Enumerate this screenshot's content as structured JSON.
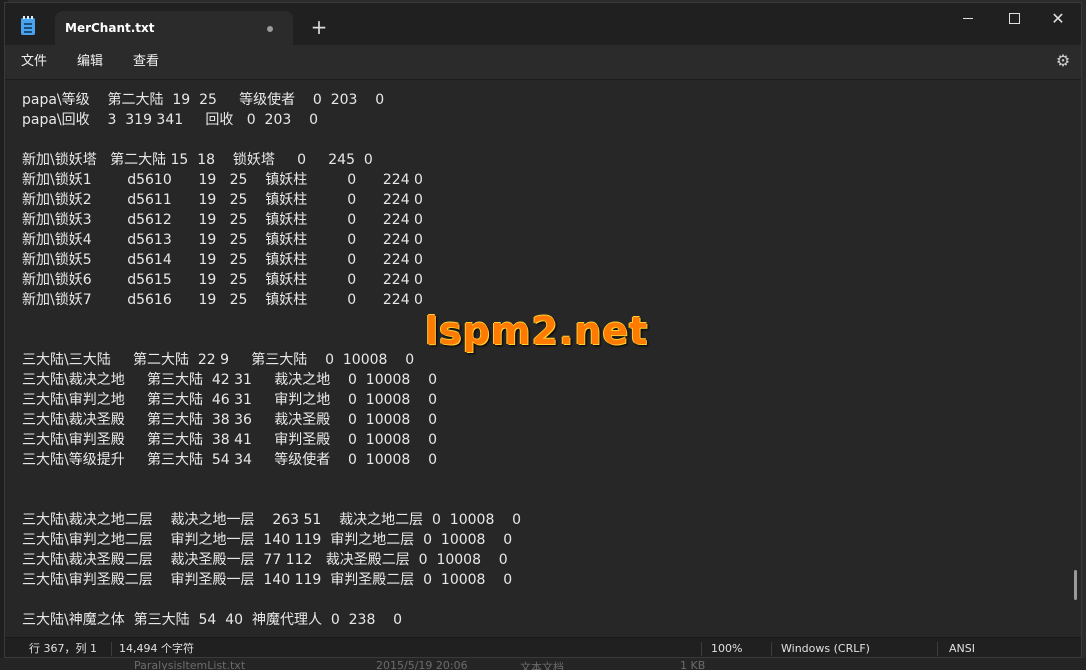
{
  "window": {
    "tab_title": "MerChant.txt",
    "new_tab_symbol": "+",
    "min_label": "",
    "close_symbol": "✕"
  },
  "menu": {
    "file": "文件",
    "edit": "编辑",
    "view": "查看"
  },
  "editor": {
    "lines": [
      "papa\\等级    第二大陆  19  25     等级使者    0  203    0",
      "papa\\回收    3  319 341     回收   0  203    0",
      "",
      "新加\\锁妖塔   第二大陆 15  18    锁妖塔     0     245  0",
      "新加\\锁妖1        d5610      19   25    镇妖柱         0      224 0",
      "新加\\锁妖2        d5611      19   25    镇妖柱         0      224 0",
      "新加\\锁妖3        d5612      19   25    镇妖柱         0      224 0",
      "新加\\锁妖4        d5613      19   25    镇妖柱         0      224 0",
      "新加\\锁妖5        d5614      19   25    镇妖柱         0      224 0",
      "新加\\锁妖6        d5615      19   25    镇妖柱         0      224 0",
      "新加\\锁妖7        d5616      19   25    镇妖柱         0      224 0",
      "",
      "",
      "三大陆\\三大陆     第二大陆  22 9     第三大陆    0  10008    0",
      "三大陆\\裁决之地     第三大陆  42 31     裁决之地    0  10008    0",
      "三大陆\\审判之地     第三大陆  46 31     审判之地    0  10008    0",
      "三大陆\\裁决圣殿     第三大陆  38 36     裁决圣殿    0  10008    0",
      "三大陆\\审判圣殿     第三大陆  38 41     审判圣殿    0  10008    0",
      "三大陆\\等级提升     第三大陆  54 34     等级使者    0  10008    0",
      "",
      "",
      "三大陆\\裁决之地二层    裁决之地一层    263 51    裁决之地二层  0  10008    0",
      "三大陆\\审判之地二层    审判之地一层  140 119  审判之地二层  0  10008    0",
      "三大陆\\裁决圣殿二层    裁决圣殿一层  77 112   裁决圣殿二层  0  10008    0",
      "三大陆\\审判圣殿二层    审判圣殿一层  140 119  审判圣殿二层  0  10008    0",
      "",
      "三大陆\\神魔之体  第三大陆  54  40  神魔代理人  0  238    0"
    ]
  },
  "watermark": "lspm2.net",
  "status": {
    "position": "行 367，列 1",
    "chars": "14,494 个字符",
    "zoom": "100%",
    "line_ending": "Windows (CRLF)",
    "encoding": "ANSI"
  },
  "background": {
    "file_name": "ParalysisItemList.txt",
    "date": "2015/5/19 20:06",
    "type": "文本文档",
    "size": "1 KB"
  },
  "colors": {
    "accent_icon": "#4aa3ef",
    "watermark": "#ff7a00"
  }
}
